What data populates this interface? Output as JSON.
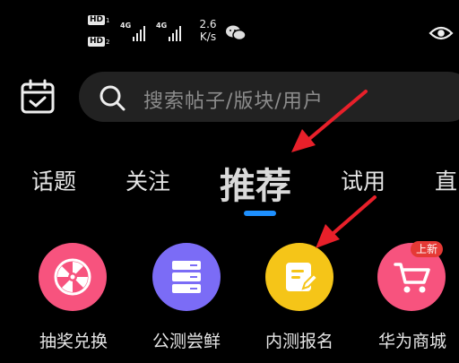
{
  "status_bar": {
    "sim1": "HD",
    "sim1_index": "1",
    "sim2": "HD",
    "sim2_index": "2",
    "network1": "4G",
    "network2": "4G",
    "speed_value": "2.6",
    "speed_unit": "K/s",
    "icons": [
      "wechat-icon",
      "eye-icon"
    ]
  },
  "header": {
    "calendar_icon": "calendar-check-icon",
    "search_placeholder": "搜索帖子/版块/用户"
  },
  "tabs": [
    {
      "label": "话题",
      "active": false
    },
    {
      "label": "关注",
      "active": false
    },
    {
      "label": "推荐",
      "active": true
    },
    {
      "label": "试用",
      "active": false
    },
    {
      "label": "直",
      "active": false
    }
  ],
  "shortcuts": [
    {
      "label": "抽奖兑换",
      "icon": "prize-wheel-icon",
      "color": "#f7537e"
    },
    {
      "label": "公测尝鲜",
      "icon": "server-stack-icon",
      "color": "#7b6cf6"
    },
    {
      "label": "内测报名",
      "icon": "note-edit-icon",
      "color": "#f5c518"
    },
    {
      "label": "华为商城",
      "icon": "shopping-cart-icon",
      "color": "#f7537e",
      "badge": "上新"
    }
  ],
  "colors": {
    "accent": "#1e90ff",
    "annotation_arrow": "#e8202a"
  }
}
